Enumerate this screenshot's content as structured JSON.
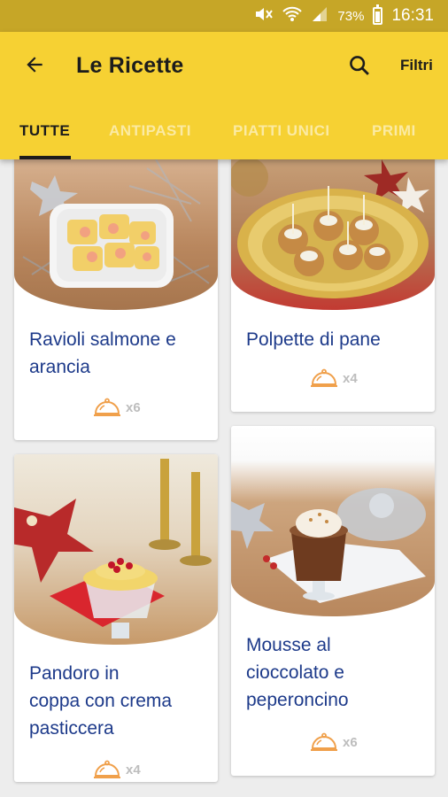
{
  "status_bar": {
    "battery": "73%",
    "time": "16:31"
  },
  "app_bar": {
    "title": "Le Ricette",
    "filter_label": "Filtri"
  },
  "tabs": [
    "TUTTE",
    "ANTIPASTI",
    "PIATTI UNICI",
    "PRIMI"
  ],
  "recipes": [
    {
      "title_lines": [
        "Ravioli salmone e",
        "arancia"
      ],
      "servings": "x6"
    },
    {
      "title_lines": [
        "Polpette di pane"
      ],
      "servings": "x4"
    },
    {
      "title_lines": [
        "Pandoro in",
        "coppa con crema",
        "pasticcera"
      ],
      "servings": "x4"
    },
    {
      "title_lines": [
        "Mousse al",
        "cioccolato e",
        "peperoncino"
      ],
      "servings": "x6"
    }
  ],
  "colors": {
    "app_bar": "#f6d133",
    "status_bar": "#c6a627",
    "title_text": "#1d3a8a",
    "cloche_icon": "#f0a04b"
  }
}
